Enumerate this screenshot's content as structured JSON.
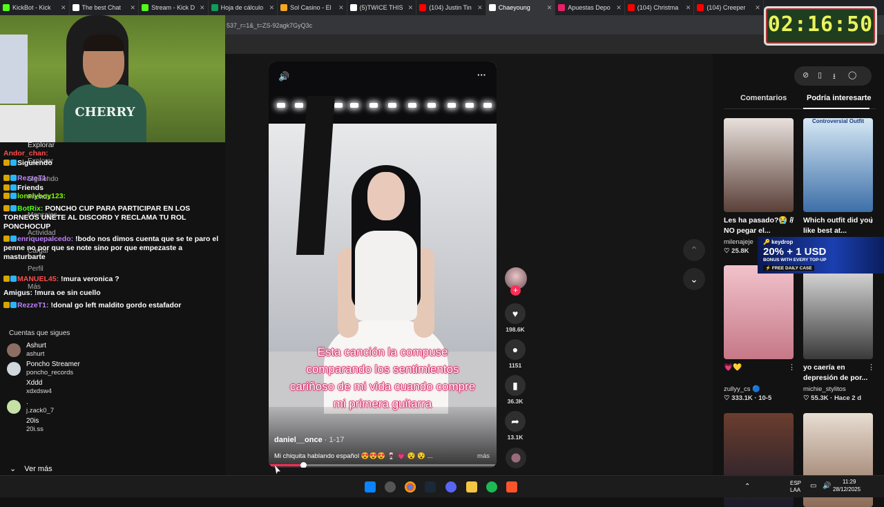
{
  "browser": {
    "tabs": [
      {
        "label": "KickBot - Kick",
        "color": "#53fc18",
        "active": false
      },
      {
        "label": "The best Chat",
        "color": "#ffffff",
        "active": false
      },
      {
        "label": "Stream - Kick D",
        "color": "#53fc18",
        "active": false
      },
      {
        "label": "Hoja de cálculo",
        "color": "#0f9d58",
        "active": false
      },
      {
        "label": "Sol Casino - El",
        "color": "#f5a623",
        "active": false
      },
      {
        "label": "(5)TWICE THIS",
        "color": "#ffffff",
        "active": false
      },
      {
        "label": "(104) Justin Tin",
        "color": "#ff0000",
        "active": false
      },
      {
        "label": "Chaeyoung",
        "color": "#ffffff",
        "active": true
      },
      {
        "label": "Apuestas Depo",
        "color": "#e91e63",
        "active": false
      },
      {
        "label": "(104) Christma",
        "color": "#ff0000",
        "active": false
      },
      {
        "label": "(104) Creeper",
        "color": "#ff0000",
        "active": false
      }
    ],
    "tab_close": "✕",
    "url_fragment": "537_r=1&_t=ZS-92agk7GyQ3c"
  },
  "timer": {
    "value": "02:16:50"
  },
  "chat": {
    "lines": [
      {
        "text": "Explorar",
        "color": "#dddddd"
      },
      {
        "user": "Andor_chan:",
        "user_color": "#ff4d4d",
        "text": ""
      },
      {
        "user": "Siguiendo",
        "user_color": "#ffffff",
        "text": ""
      },
      {
        "user": "RezzeT1:",
        "user_color": "#bf7fff",
        "text": ""
      },
      {
        "user": "Friends",
        "user_color": "#ffffff",
        "text": ""
      },
      {
        "user": "lonelyboy123:",
        "user_color": "#7cfc00",
        "text": ""
      },
      {
        "user": "BotRix:",
        "user_color": "#53fc18",
        "text": "PONCHO CUP PARA PARTICIPAR EN LOS TORNEOS UNETE AL DISCORD Y RECLAMA TU ROL PONCHOCUP"
      },
      {
        "user": "enriquepalcedo:",
        "user_color": "#bf7fff",
        "text": "!bodo nos dimos cuenta que se te paro el penne no por que se note sino por que empezaste a masturbarte"
      },
      {
        "user": "MANUEL45:",
        "user_color": "#ff4d4d",
        "text": "!mura veronica ?"
      },
      {
        "user": "Amigus:",
        "user_color": "#ffffff",
        "text": "!mura oe sin cuello"
      },
      {
        "user": "RezzeT1:",
        "user_color": "#bf7fff",
        "text": "!donal go left maldito gordo estafador"
      }
    ],
    "nav_ghosts": [
      "Explorar",
      "Siguiendo",
      "Friends",
      "Mensajes",
      "Actividad",
      "Cargar",
      "Perfil",
      "Más"
    ]
  },
  "following": {
    "heading": "Cuentas que sigues",
    "accounts": [
      {
        "name": "Ashurt",
        "handle": "ashurt",
        "avatar": "#8d6e63"
      },
      {
        "name": "Poncho Streamer",
        "handle": "poncho_records",
        "avatar": "#cfd8dc"
      },
      {
        "name": "Xddd",
        "handle": "xdxdsw4",
        "avatar": ""
      },
      {
        "name": ".",
        "handle": "j.zack0_7",
        "avatar": "#c5e1a5"
      },
      {
        "name": "20is",
        "handle": "20i.ss",
        "avatar": ""
      }
    ],
    "see_more": "Ver más",
    "chevron": "⌄"
  },
  "video": {
    "caption_lines": [
      "Esta canción la compuse",
      "comparando los sentimientos",
      "cariñoso de mi vida cuando compre",
      "mi primera guitarra"
    ],
    "author": "daniel__once",
    "date": " · 1-17",
    "description": "Mi chiquita hablando español 😍😍😍 🍷 💗 😵 😵 ...",
    "more": "más",
    "progress": 0.15,
    "sound_icon": "🔊",
    "menu_icon": "···"
  },
  "actions": {
    "likes": "198.6K",
    "comments": "1151",
    "saves": "36.3K",
    "shares": "13.1K",
    "follow_plus": "+"
  },
  "nav": {
    "up": "⌃",
    "down": "⌄"
  },
  "right": {
    "tab_comments": "Comentarios",
    "tab_interest": "Podría interesarte",
    "tool_icons": [
      "⊘",
      "▯",
      "⭳",
      "◯"
    ],
    "cards": [
      {
        "title": "Les ha pasado?😭 // NO pegar el...",
        "user": "milenajeje",
        "stats": "♡ 25.8K",
        "overlay": "",
        "colors": [
          "#e8e0dc",
          "#5a4038"
        ]
      },
      {
        "title": "Which outfit did you like best at...",
        "user": "",
        "stats": "",
        "overlay": "Controversial Outfit",
        "colors": [
          "#d6e8f5",
          "#3d6fa8"
        ]
      },
      {
        "title": "💗💛",
        "user": "zullyy_cs 🔵",
        "stats": "♡ 333.1K · 10-5",
        "overlay": "",
        "colors": [
          "#f1c3cc",
          "#c67887"
        ]
      },
      {
        "title": "yo caería en depresión de por...",
        "user": "michie_stylitos",
        "stats": "♡ 55.3K · Hace 2 d",
        "overlay": "",
        "colors": [
          "#e0e0e0",
          "#3a3a3a"
        ]
      },
      {
        "title": "",
        "user": "",
        "stats": "",
        "overlay": "",
        "colors": [
          "#6b3d2e",
          "#1b1b2a"
        ]
      },
      {
        "title": "",
        "user": "",
        "stats": "",
        "overlay": "",
        "colors": [
          "#e8ddd2",
          "#8c6b56"
        ]
      }
    ],
    "dots": "⋮"
  },
  "ad": {
    "brand": "🔑 keydrop",
    "promo": "20% + 1 USD",
    "promo2": "BONUS WITH EVERY TOP-UP",
    "promo3": "⚡ FREE DAILY CASE"
  },
  "taskbar": {
    "lang": "ESP",
    "lang2": "LAA",
    "time": "11:29",
    "date": "28/12/2025"
  }
}
